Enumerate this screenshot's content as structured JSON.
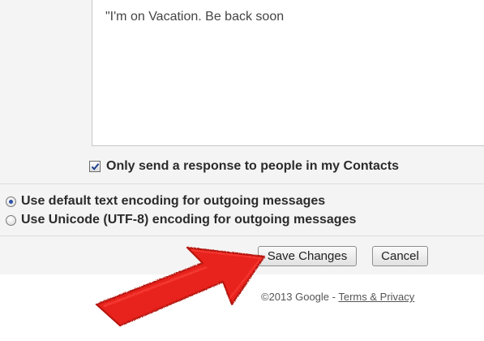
{
  "vacation": {
    "message_text": "\"I'm on Vacation. Be back soon",
    "contacts_only_label": "Only send a response to people in my Contacts",
    "contacts_only_checked": true
  },
  "encoding": {
    "default_label": "Use default text encoding for outgoing messages",
    "unicode_label": "Use Unicode (UTF-8) encoding for outgoing messages",
    "selected": "default"
  },
  "actions": {
    "save_label": "Save Changes",
    "cancel_label": "Cancel"
  },
  "footer": {
    "copyright": "©2013 Google - ",
    "link_label": "Terms & Privacy"
  },
  "annotation": {
    "arrow_color": "#e8201c",
    "arrow_icon": "red-pointer-arrow"
  }
}
